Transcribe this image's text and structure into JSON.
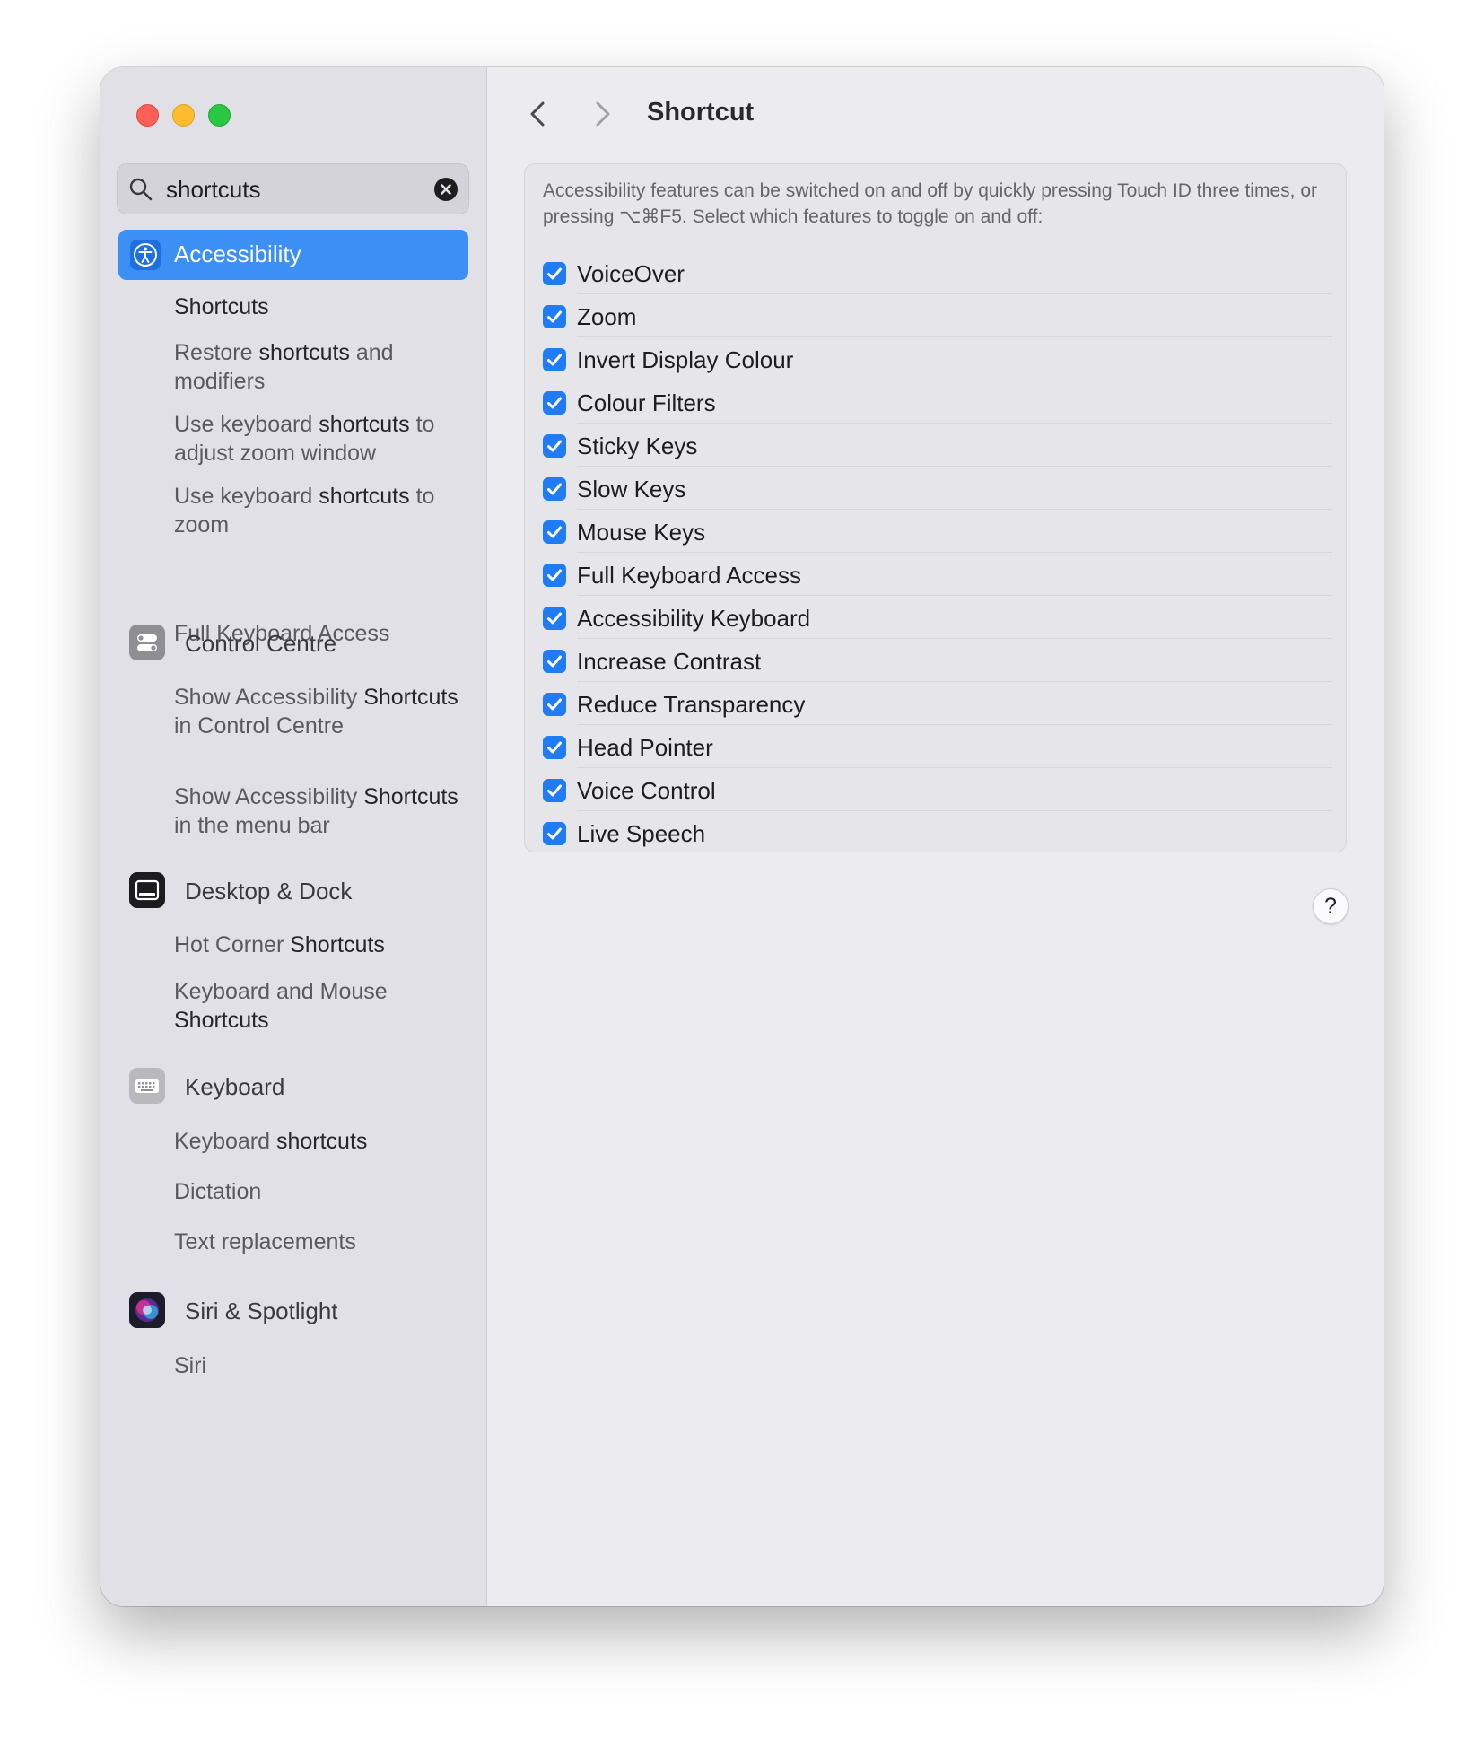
{
  "search": {
    "value": "shortcuts"
  },
  "sidebar": {
    "selected": {
      "label": "Accessibility"
    },
    "accessibility_subs": [
      {
        "plain": "",
        "bold": "Shortcuts",
        "rest": ""
      },
      {
        "plain": "Restore ",
        "bold": "shortcuts",
        "rest": " and modifiers"
      },
      {
        "plain": "Use keyboard ",
        "bold": "shortcuts",
        "rest": " to adjust zoom window"
      },
      {
        "plain": "Use keyboard ",
        "bold": "shortcuts",
        "rest": " to zoom"
      },
      {
        "plain": "Full Keyboard Access",
        "bold": "",
        "rest": ""
      }
    ],
    "control_centre": {
      "label": "Control Centre",
      "subs": [
        {
          "plain": "Show Accessibility ",
          "bold": "Shortcuts",
          "rest": " in Control Centre"
        },
        {
          "plain": "Show Accessibility ",
          "bold": "Shortcuts",
          "rest": " in the menu bar"
        }
      ]
    },
    "desktop_dock": {
      "label": "Desktop & Dock",
      "subs": [
        {
          "plain": "Hot Corner ",
          "bold": "Shortcuts",
          "rest": ""
        },
        {
          "plain": "Keyboard and Mouse ",
          "bold": "Shortcuts",
          "rest": ""
        }
      ]
    },
    "keyboard": {
      "label": "Keyboard",
      "subs": [
        {
          "plain": "Keyboard ",
          "bold": "shortcuts",
          "rest": ""
        },
        {
          "plain": "Dictation",
          "bold": "",
          "rest": ""
        },
        {
          "plain": "Text replacements",
          "bold": "",
          "rest": ""
        }
      ]
    },
    "siri": {
      "label": "Siri & Spotlight",
      "subs": [
        {
          "plain": "Siri",
          "bold": "",
          "rest": ""
        }
      ]
    }
  },
  "main": {
    "title": "Shortcut",
    "description": "Accessibility features can be switched on and off by quickly pressing Touch ID three times, or pressing ⌥⌘F5. Select which features to toggle on and off:",
    "features": [
      {
        "label": "VoiceOver",
        "checked": true
      },
      {
        "label": "Zoom",
        "checked": true
      },
      {
        "label": "Invert Display Colour",
        "checked": true
      },
      {
        "label": "Colour Filters",
        "checked": true
      },
      {
        "label": "Sticky Keys",
        "checked": true
      },
      {
        "label": "Slow Keys",
        "checked": true
      },
      {
        "label": "Mouse Keys",
        "checked": true
      },
      {
        "label": "Full Keyboard Access",
        "checked": true
      },
      {
        "label": "Accessibility Keyboard",
        "checked": true
      },
      {
        "label": "Increase Contrast",
        "checked": true
      },
      {
        "label": "Reduce Transparency",
        "checked": true
      },
      {
        "label": "Head Pointer",
        "checked": true
      },
      {
        "label": "Voice Control",
        "checked": true
      },
      {
        "label": "Live Speech",
        "checked": true
      }
    ],
    "help_label": "?"
  },
  "colors": {
    "accent": "#1f7cf4",
    "selected_bg": "#3b8ff5"
  }
}
